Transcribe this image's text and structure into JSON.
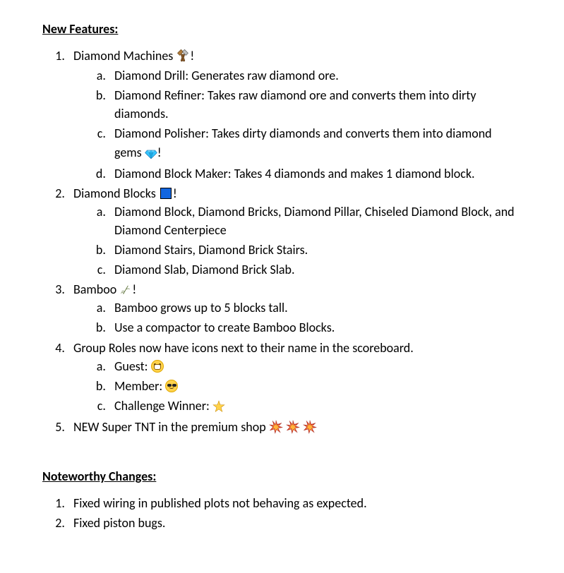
{
  "sections": {
    "new_features": {
      "title": "New Features:",
      "items": [
        {
          "prefix": "Diamond Machines ",
          "icon": "hammer-pick",
          "suffix": "!",
          "sub": [
            "Diamond Drill: Generates raw diamond ore.",
            "Diamond Refiner: Takes raw diamond ore and converts them into dirty diamonds.",
            {
              "prefix": "Diamond Polisher: Takes dirty diamonds and converts them into diamond gems ",
              "icon": "gem",
              "suffix": "!"
            },
            "Diamond Block Maker: Takes 4 diamonds and makes 1 diamond block."
          ]
        },
        {
          "prefix": "Diamond Blocks ",
          "icon": "blue-square",
          "suffix": "!",
          "sub": [
            "Diamond Block, Diamond Bricks, Diamond Pillar, Chiseled Diamond Block, and Diamond Centerpiece",
            "Diamond Stairs, Diamond Brick Stairs.",
            "Diamond Slab, Diamond Brick Slab."
          ]
        },
        {
          "prefix": "Bamboo ",
          "icon": "bamboo",
          "suffix": "!",
          "sub": [
            "Bamboo grows up to 5 blocks tall.",
            "Use a compactor to create Bamboo Blocks."
          ]
        },
        {
          "prefix": "Group Roles now have icons next to their name in the scoreboard.",
          "icon": null,
          "suffix": "",
          "sub": [
            {
              "prefix": "Guest: ",
              "icon": "face-grin",
              "suffix": ""
            },
            {
              "prefix": "Member: ",
              "icon": "face-shades",
              "suffix": ""
            },
            {
              "prefix": "Challenge Winner: ",
              "icon": "star",
              "suffix": ""
            }
          ]
        },
        {
          "prefix": "NEW Super TNT in the premium shop ",
          "icon": "boom-triple",
          "suffix": "",
          "sub": []
        }
      ]
    },
    "noteworthy_changes": {
      "title": "Noteworthy Changes:",
      "items": [
        "Fixed wiring in published plots not behaving as expected.",
        "Fixed piston bugs."
      ]
    }
  }
}
